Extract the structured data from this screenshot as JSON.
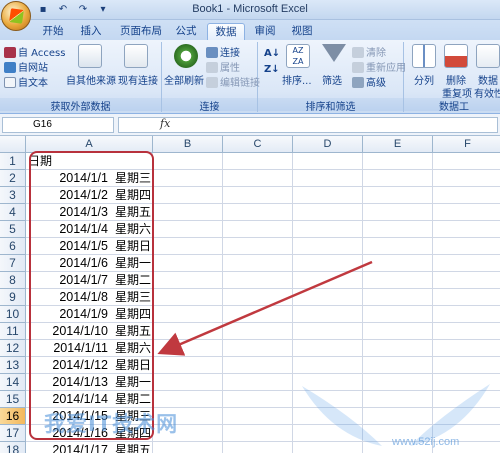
{
  "window": {
    "title": "Book1 - Microsoft Excel"
  },
  "qat": {
    "save_icon": "save-icon",
    "undo_icon": "undo-icon",
    "redo_icon": "redo-icon",
    "more": "▾"
  },
  "tabs": [
    {
      "label": "开始",
      "active": false
    },
    {
      "label": "插入",
      "active": false
    },
    {
      "label": "页面布局",
      "active": false
    },
    {
      "label": "公式",
      "active": false
    },
    {
      "label": "数据",
      "active": true
    },
    {
      "label": "审阅",
      "active": false
    },
    {
      "label": "视图",
      "active": false
    }
  ],
  "ribbon": {
    "external": {
      "label": "获取外部数据",
      "access": "自 Access",
      "web": "自网站",
      "text": "自文本",
      "other": "自其他来源",
      "existing": "现有连接"
    },
    "connections": {
      "label": "连接",
      "refresh_all": "全部刷新",
      "conn": "连接",
      "props": "属性",
      "edit_links": "编辑链接"
    },
    "sort_filter": {
      "label": "排序和筛选",
      "sort": "排序...",
      "filter": "筛选",
      "clear": "清除",
      "reapply": "重新应用",
      "advanced": "高级"
    },
    "tools": {
      "label": "数据工",
      "split": "分列",
      "remove_dup_1": "删除",
      "remove_dup_2": "重复项",
      "validation_1": "数据",
      "validation_2": "有效性"
    }
  },
  "formula_bar": {
    "name_box": "G16",
    "fx": "fx",
    "value": ""
  },
  "columns": [
    "A",
    "B",
    "C",
    "D",
    "E",
    "F"
  ],
  "header_cell": "日期",
  "rows": [
    {
      "n": "1"
    },
    {
      "n": "2",
      "date": "2014/1/1",
      "wd": "星期三"
    },
    {
      "n": "3",
      "date": "2014/1/2",
      "wd": "星期四"
    },
    {
      "n": "4",
      "date": "2014/1/3",
      "wd": "星期五"
    },
    {
      "n": "5",
      "date": "2014/1/4",
      "wd": "星期六"
    },
    {
      "n": "6",
      "date": "2014/1/5",
      "wd": "星期日"
    },
    {
      "n": "7",
      "date": "2014/1/6",
      "wd": "星期一"
    },
    {
      "n": "8",
      "date": "2014/1/7",
      "wd": "星期二"
    },
    {
      "n": "9",
      "date": "2014/1/8",
      "wd": "星期三"
    },
    {
      "n": "10",
      "date": "2014/1/9",
      "wd": "星期四"
    },
    {
      "n": "11",
      "date": "2014/1/10",
      "wd": "星期五"
    },
    {
      "n": "12",
      "date": "2014/1/11",
      "wd": "星期六"
    },
    {
      "n": "13",
      "date": "2014/1/12",
      "wd": "星期日"
    },
    {
      "n": "14",
      "date": "2014/1/13",
      "wd": "星期一"
    },
    {
      "n": "15",
      "date": "2014/1/14",
      "wd": "星期二"
    },
    {
      "n": "16",
      "date": "2014/1/15",
      "wd": "星期三",
      "selected": true
    },
    {
      "n": "17",
      "date": "2014/1/16",
      "wd": "星期四"
    },
    {
      "n": "18",
      "date": "2014/1/17",
      "wd": "星期五"
    }
  ],
  "watermark": {
    "text": "我爱IT技术网",
    "url": "www.52ij.com"
  },
  "colors": {
    "accent": "#15428b",
    "outline": "#b8313c",
    "selected_row": "#f3b85b"
  }
}
